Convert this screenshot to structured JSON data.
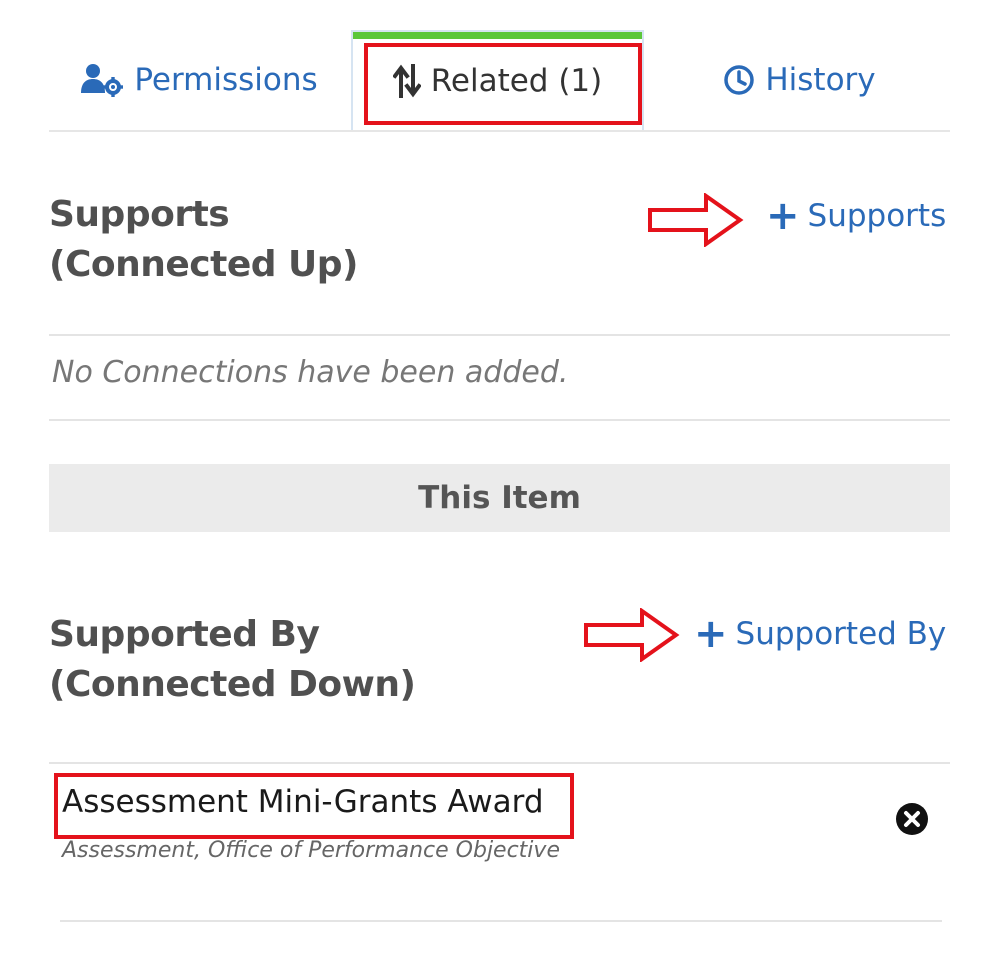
{
  "tabs": [
    {
      "label": "Permissions",
      "icon": "users-gear-icon"
    },
    {
      "label": "Related (1)",
      "icon": "sort-arrows-icon",
      "active": true
    },
    {
      "label": "History",
      "icon": "clock-icon"
    }
  ],
  "supports": {
    "title_line1": "Supports",
    "title_line2": "(Connected Up)",
    "add_label": "Supports",
    "empty_text": "No Connections have been added."
  },
  "this_item": {
    "label": "This Item"
  },
  "supported_by": {
    "title_line1": "Supported By",
    "title_line2": "(Connected Down)",
    "add_label": "Supported By",
    "items": [
      {
        "title": "Assessment Mini-Grants Award",
        "subtitle": "Assessment, Office of Performance Objective"
      }
    ]
  },
  "colors": {
    "link": "#2a6ab8",
    "active_tab_bar": "#5cc73a",
    "annotation": "#e4121b"
  }
}
